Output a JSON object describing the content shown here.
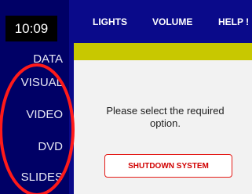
{
  "clock": {
    "time": "10:09"
  },
  "topnav": {
    "items": [
      {
        "label": "LIGHTS"
      },
      {
        "label": "VOLUME"
      },
      {
        "label": "HELP !"
      }
    ]
  },
  "sidebar": {
    "items": [
      {
        "label": "DATA"
      },
      {
        "label": "VISUAL"
      },
      {
        "label": "VIDEO"
      },
      {
        "label": "DVD"
      },
      {
        "label": "SLIDES"
      }
    ]
  },
  "main": {
    "message": "Please select the required option.",
    "shutdown_label": "SHUTDOWN SYSTEM"
  },
  "colors": {
    "background": "#0a0a8a",
    "sidebar": "#000066",
    "accent_bar": "#c8c800",
    "panel": "#f2f2f2",
    "shutdown_text": "#d10000",
    "annotation": "#ff1a1a"
  }
}
